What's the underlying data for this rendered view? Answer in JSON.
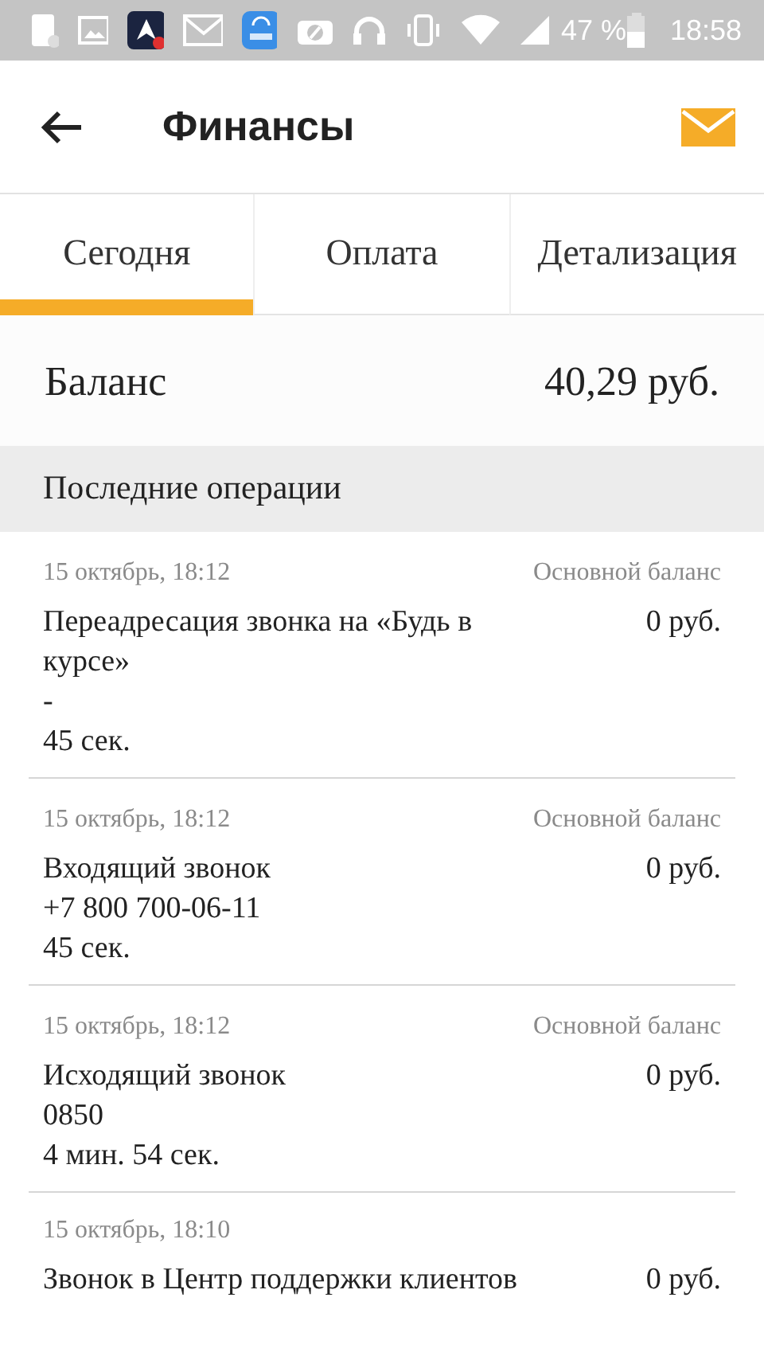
{
  "status_bar": {
    "battery_text": "47 %",
    "time": "18:58"
  },
  "header": {
    "title": "Финансы"
  },
  "tabs": [
    {
      "label": "Сегодня",
      "selected": true
    },
    {
      "label": "Оплата",
      "selected": false
    },
    {
      "label": "Детализация",
      "selected": false
    }
  ],
  "balance": {
    "label": "Баланс",
    "value": "40,29 руб."
  },
  "section": {
    "title": "Последние операции"
  },
  "operations": [
    {
      "date": "15 октябрь, 18:12",
      "account": "Основной баланс",
      "lines": [
        "Переадресация звонка на «Будь в курсе»",
        "-",
        "45 сек."
      ],
      "amount": "0 руб."
    },
    {
      "date": "15 октябрь, 18:12",
      "account": "Основной баланс",
      "lines": [
        "Входящий звонок",
        "+7 800 700-06-11",
        "45 сек."
      ],
      "amount": "0 руб."
    },
    {
      "date": "15 октябрь, 18:12",
      "account": "Основной баланс",
      "lines": [
        "Исходящий звонок",
        "0850",
        "4 мин. 54 сек."
      ],
      "amount": "0 руб."
    },
    {
      "date": "15 октябрь, 18:10",
      "lines": [
        "Звонок в Центр поддержки клиентов"
      ],
      "amount": "0 руб."
    }
  ]
}
